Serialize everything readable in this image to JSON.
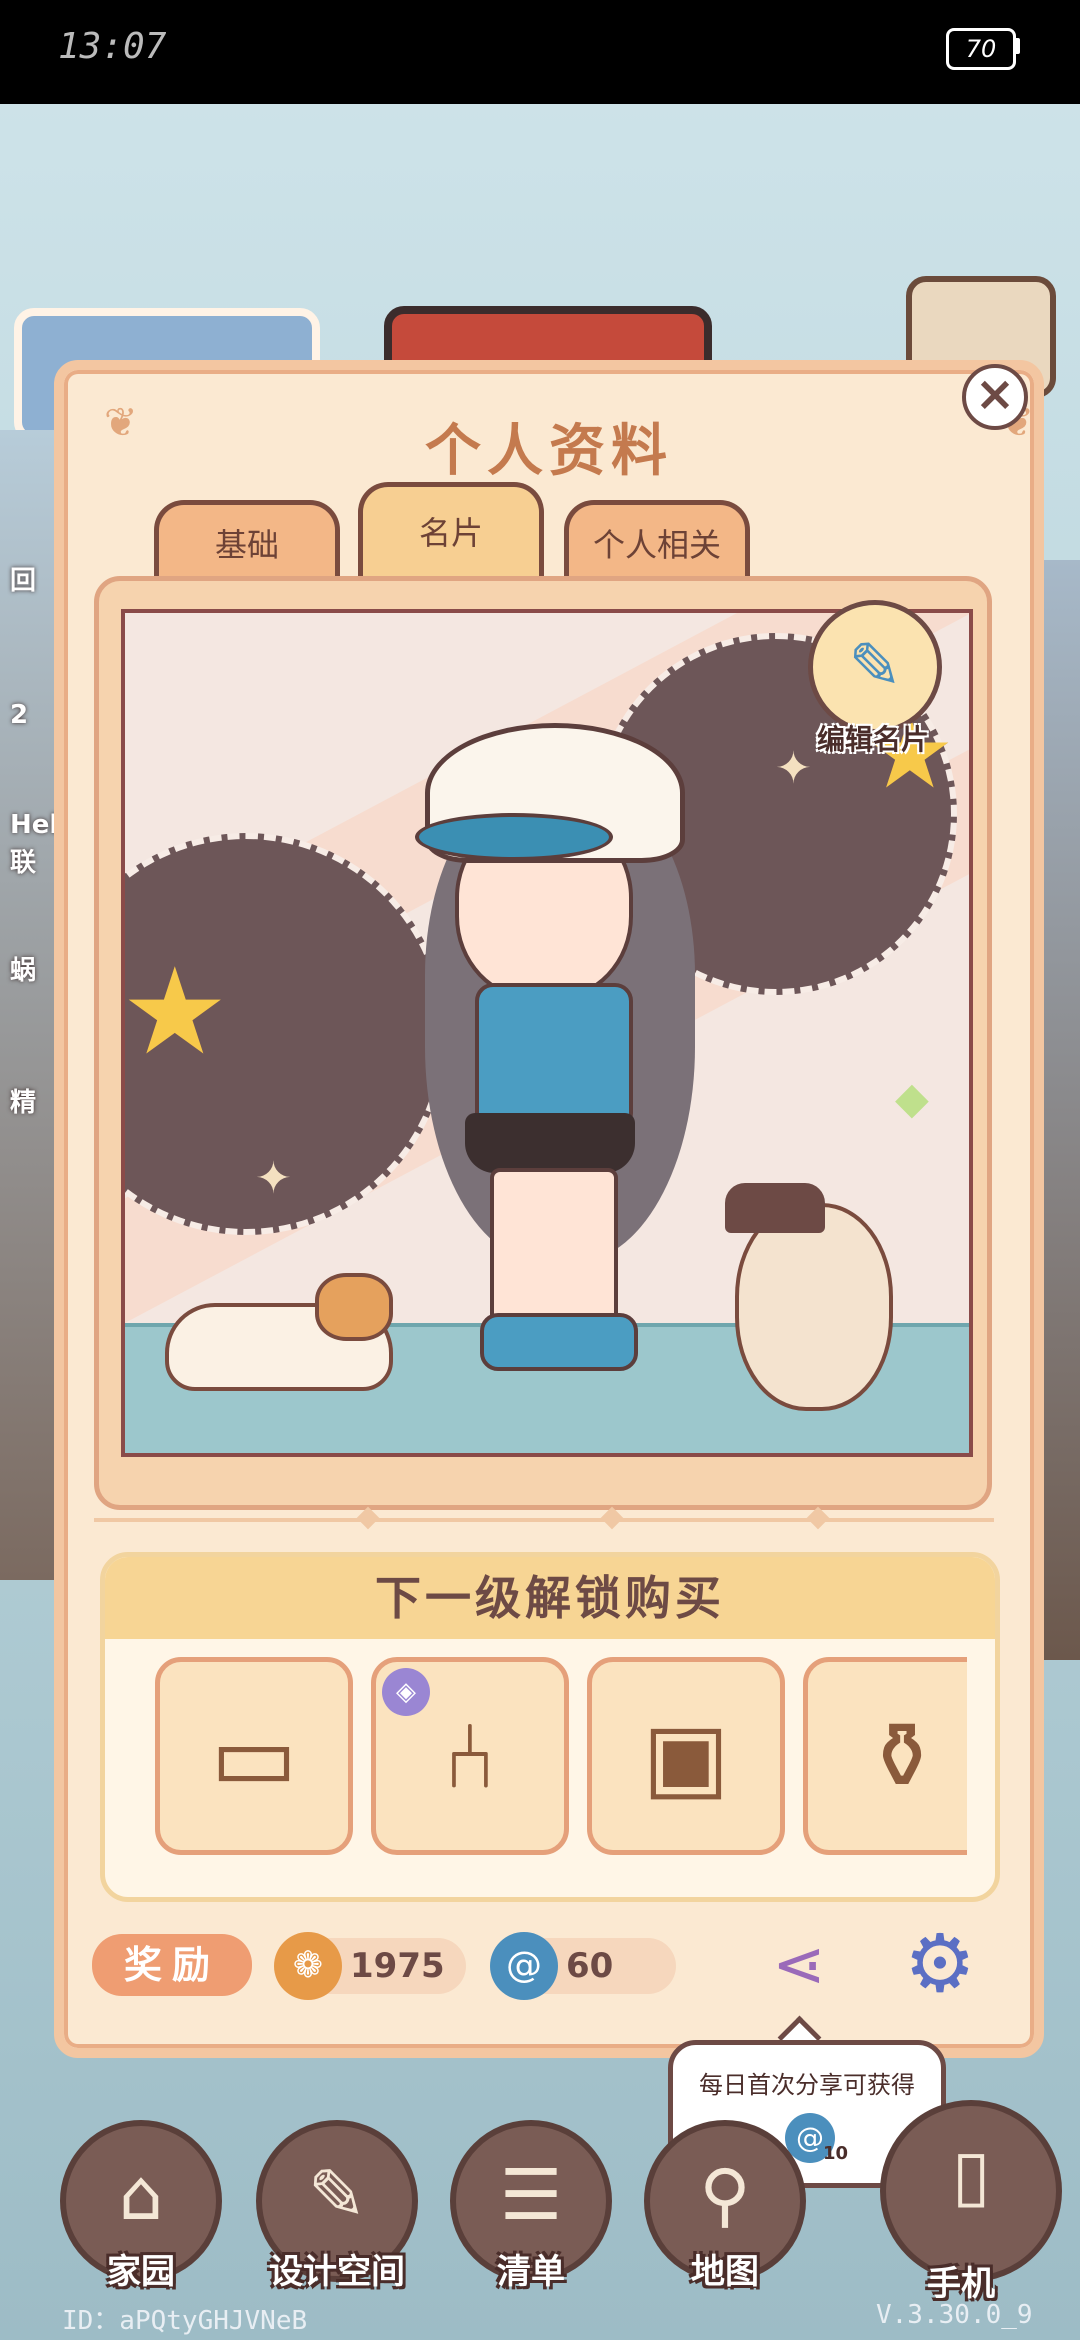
{
  "status": {
    "time": "13:07",
    "battery": "70"
  },
  "background": {
    "left_labels": [
      "回",
      "2",
      "Hel",
      "联",
      "蜗",
      "精"
    ]
  },
  "panel": {
    "title": "个人资料",
    "tabs": [
      {
        "label": "基础",
        "active": false
      },
      {
        "label": "名片",
        "active": true
      },
      {
        "label": "个人相关",
        "active": false
      }
    ],
    "edit_card_label": "编辑名片",
    "unlock_title": "下一级解锁购买",
    "unlock_items": [
      {
        "icon": "table-icon",
        "glyph": "▭"
      },
      {
        "icon": "chair-icon",
        "glyph": "⑃",
        "badge": true
      },
      {
        "icon": "cabinet-icon",
        "glyph": "▣"
      },
      {
        "icon": "vase-flower-icon",
        "glyph": "⚱"
      }
    ],
    "reward_label": "奖励",
    "coins": "1975",
    "gems": "60"
  },
  "tooltip": {
    "text": "每日首次分享可获得",
    "reward_count": "10"
  },
  "nav": [
    {
      "label": "家园",
      "icon": "home-icon",
      "glyph": "⌂"
    },
    {
      "label": "设计空间",
      "icon": "design-space-icon",
      "glyph": "✎"
    },
    {
      "label": "清单",
      "icon": "list-icon",
      "glyph": "☰"
    },
    {
      "label": "地图",
      "icon": "map-icon",
      "glyph": "⚲"
    },
    {
      "label": "手机",
      "icon": "phone-icon",
      "glyph": "▯"
    }
  ],
  "footer": {
    "id": "ID：aPQtyGHJVNeB",
    "version": "V.3.30.0_9"
  },
  "colors": {
    "accent": "#c47a4e",
    "panel_bg": "#fbe9d2",
    "tab_active": "#f7cf92"
  }
}
